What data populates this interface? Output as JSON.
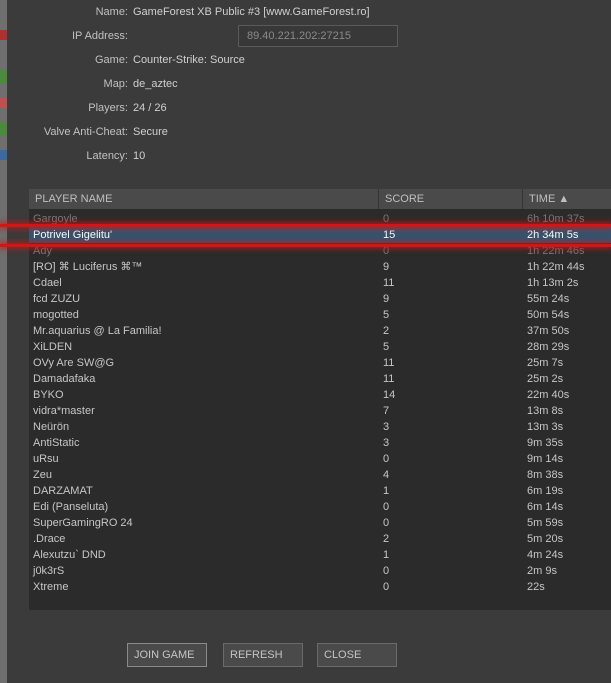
{
  "server_info": {
    "rows": [
      {
        "label": "Name:",
        "value": "GameForest XB Public #3 [www.GameForest.ro]"
      },
      {
        "label": "IP Address:",
        "value": "89.40.221.202:27215"
      },
      {
        "label": "Game:",
        "value": "Counter-Strike: Source"
      },
      {
        "label": "Map:",
        "value": "de_aztec"
      },
      {
        "label": "Players:",
        "value": "24 / 26"
      },
      {
        "label": "Valve Anti-Cheat:",
        "value": "Secure"
      },
      {
        "label": "Latency:",
        "value": "10"
      }
    ]
  },
  "table": {
    "headers": {
      "name": "PLAYER NAME",
      "score": "SCORE",
      "time": "TIME ▲"
    },
    "rows": [
      {
        "name": "Gargoyle",
        "score": "0",
        "time": "6h 10m 37s",
        "state": "dim"
      },
      {
        "name": "Potrivel Gigelitu'",
        "score": "15",
        "time": "2h 34m 5s",
        "state": "selected"
      },
      {
        "name": "Ady",
        "score": "0",
        "time": "1h 22m 46s",
        "state": "dim"
      },
      {
        "name": "[RO] ⌘ Luciferus ⌘™",
        "score": "9",
        "time": "1h 22m 44s"
      },
      {
        "name": "Cdael",
        "score": "11",
        "time": "1h 13m 2s"
      },
      {
        "name": "fcd ZUZU",
        "score": "9",
        "time": "55m 24s"
      },
      {
        "name": "mogotted",
        "score": "5",
        "time": "50m 54s"
      },
      {
        "name": "Mr.aquarius @ La Familia!",
        "score": "2",
        "time": "37m 50s"
      },
      {
        "name": "XiLDEN",
        "score": "5",
        "time": "28m 29s"
      },
      {
        "name": "OVy Are SW@G",
        "score": "11",
        "time": "25m 7s"
      },
      {
        "name": "Damadafaka",
        "score": "11",
        "time": "25m 2s"
      },
      {
        "name": "BYKO",
        "score": "14",
        "time": "22m 40s"
      },
      {
        "name": "vidra*master",
        "score": "7",
        "time": "13m 8s"
      },
      {
        "name": "Neürön",
        "score": "3",
        "time": "13m 3s"
      },
      {
        "name": "AntiStatic",
        "score": "3",
        "time": "9m 35s"
      },
      {
        "name": "uRsu",
        "score": "0",
        "time": "9m 14s"
      },
      {
        "name": "Zeu",
        "score": "4",
        "time": "8m 38s"
      },
      {
        "name": "DARZAMAT",
        "score": "1",
        "time": "6m 19s"
      },
      {
        "name": "Edi (Panseluta)",
        "score": "0",
        "time": "6m 14s"
      },
      {
        "name": "SuperGamingRO 24",
        "score": "0",
        "time": "5m 59s"
      },
      {
        "name": ".Drace",
        "score": "2",
        "time": "5m 20s"
      },
      {
        "name": "Alexutzu` DND",
        "score": "1",
        "time": "4m 24s"
      },
      {
        "name": "j0k3rS",
        "score": "0",
        "time": "2m 9s"
      },
      {
        "name": "Xtreme",
        "score": "0",
        "time": "22s"
      }
    ]
  },
  "buttons": {
    "join": "JOIN GAME",
    "refresh": "REFRESH",
    "close": "CLOSE"
  },
  "colors": {
    "selected_row": "#34546e",
    "highlight_line": "#d41515"
  }
}
